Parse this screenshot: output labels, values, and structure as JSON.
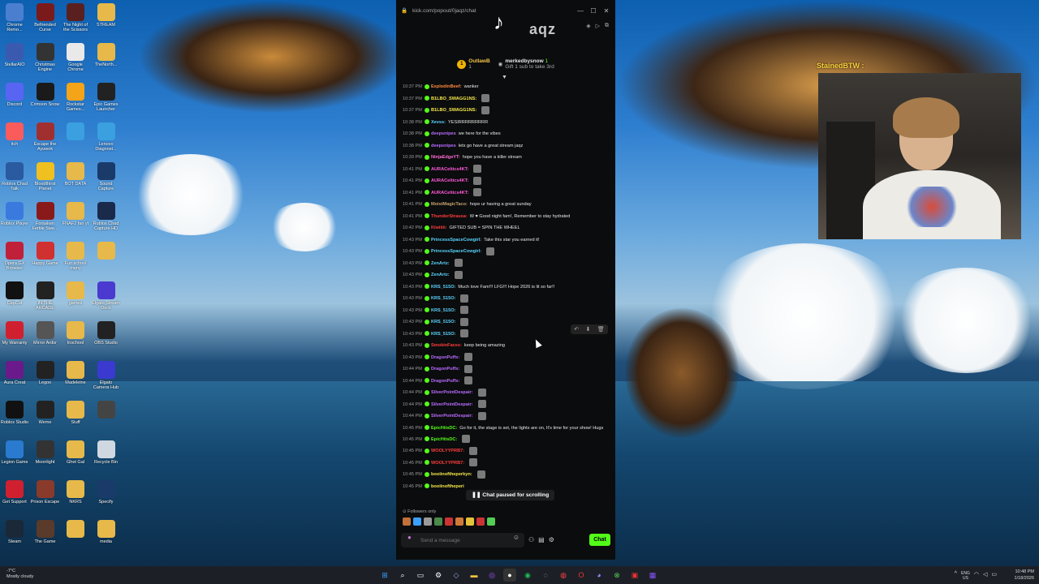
{
  "desktop": {
    "icons": [
      {
        "label": "Chrome Remo...",
        "color": "#4a7fd0"
      },
      {
        "label": "Befriended Curse",
        "color": "#7a1a1a"
      },
      {
        "label": "The Night of the Scissors",
        "color": "#5a2020"
      },
      {
        "label": "STREAM",
        "color": "#e6b94a"
      },
      {
        "label": "StellarAIO",
        "color": "#3a5ab0"
      },
      {
        "label": "Christmas Engine",
        "color": "#333333"
      },
      {
        "label": "Google Chrome",
        "color": "#e9e9e9"
      },
      {
        "label": "TheNorth...",
        "color": "#e6b94a"
      },
      {
        "label": "Discord",
        "color": "#5865f2"
      },
      {
        "label": "Crimson Snow",
        "color": "#1a1a1a"
      },
      {
        "label": "Rockstar Games...",
        "color": "#f4a418"
      },
      {
        "label": "Epic Games Launcher",
        "color": "#222222"
      },
      {
        "label": "itch",
        "color": "#fa5c5c"
      },
      {
        "label": "Escape the Ayuwok",
        "color": "#a03030"
      },
      {
        "label": "",
        "color": "#3aa0e0"
      },
      {
        "label": "Lenovo Diagnost...",
        "color": "#3aa0e0"
      },
      {
        "label": "Roblox Chad Talk",
        "color": "#2a5aa0"
      },
      {
        "label": "Bloodthirst Planet",
        "color": "#f0c020"
      },
      {
        "label": "BOT DATA",
        "color": "#e6b94a"
      },
      {
        "label": "Sound Capture",
        "color": "#1a3a6a"
      },
      {
        "label": "Roblox Player",
        "color": "#3a7adf"
      },
      {
        "label": "Forsaken Fertile Swe...",
        "color": "#8a1a1a"
      },
      {
        "label": "FNAF2 fan yt",
        "color": "#e6b94a"
      },
      {
        "label": "Roblox Chad Capture HD",
        "color": "#1a2a4a"
      },
      {
        "label": "Opera GX Browser",
        "color": "#c0203a"
      },
      {
        "label": "Happy Game",
        "color": "#d03030"
      },
      {
        "label": "Fun school meny",
        "color": "#e6b94a"
      },
      {
        "label": "",
        "color": "#e6b94a"
      },
      {
        "label": "CapCut",
        "color": "#111111"
      },
      {
        "label": "IN THE ARCADE",
        "color": "#222222"
      },
      {
        "label": "games",
        "color": "#e6b94a"
      },
      {
        "label": "Elgato Stream Deck",
        "color": "#4a3ad0"
      },
      {
        "label": "My Warranty",
        "color": "#d02030"
      },
      {
        "label": "Mirror Ardor",
        "color": "#555555"
      },
      {
        "label": "Inschool",
        "color": "#e6b94a"
      },
      {
        "label": "OBS Studio",
        "color": "#222222"
      },
      {
        "label": "Aura Creat",
        "color": "#6a1a8a"
      },
      {
        "label": "Legoo",
        "color": "#222222"
      },
      {
        "label": "Madeleine",
        "color": "#e6b94a"
      },
      {
        "label": "Elgato Camera Hub",
        "color": "#3a3ad0"
      },
      {
        "label": "Roblox Studio",
        "color": "#111111"
      },
      {
        "label": "Weme",
        "color": "#222222"
      },
      {
        "label": "Stuff",
        "color": "#e6b94a"
      },
      {
        "label": "",
        "color": "#444444"
      },
      {
        "label": "Legion Game",
        "color": "#2a7ad0"
      },
      {
        "label": "Moonlight",
        "color": "#333333"
      },
      {
        "label": "Ghet Gal",
        "color": "#e6b94a"
      },
      {
        "label": "Recycle Bin",
        "color": "#cfd8e0"
      },
      {
        "label": "Get Support",
        "color": "#d02030"
      },
      {
        "label": "Prison Escape",
        "color": "#8a3a2a"
      },
      {
        "label": "NKRS",
        "color": "#e6b94a"
      },
      {
        "label": "Specify",
        "color": "#1a3a6a"
      },
      {
        "label": "Steam",
        "color": "#1b2838"
      },
      {
        "label": "The Game",
        "color": "#5a3a2a"
      },
      {
        "label": "",
        "color": "#e6b94a"
      },
      {
        "label": "media",
        "color": "#e6b94a"
      }
    ]
  },
  "chat_window": {
    "url": "kick.com/popout/0jaqz/chat",
    "logo_glyph": "♪",
    "channel_name": "aqz",
    "pinned": {
      "user1": "OutlawB",
      "user1_count": "1",
      "user2": "merkedbysnow",
      "user2_note": "Gift 1 sub to take 3rd",
      "user2_count": "1"
    },
    "messages": [
      {
        "time": "10:37 PM",
        "user": "ExplodinBeef:",
        "text": "wanker",
        "color": "#ff8a3d",
        "emote": false
      },
      {
        "time": "10:37 PM",
        "user": "B1LBO_SWAGG1NS:",
        "text": "",
        "color": "#f7e94a",
        "emote": true
      },
      {
        "time": "10:37 PM",
        "user": "B1LBO_SWAGG1NS:",
        "text": "",
        "color": "#f7e94a",
        "emote": true
      },
      {
        "time": "10:38 PM",
        "user": "Xevss:",
        "text": "YESIRRRRRRRRR",
        "color": "#5ad5ff",
        "emote": false
      },
      {
        "time": "10:38 PM",
        "user": "deepsnipes",
        "text": "we here for the vibes",
        "color": "#b86bff",
        "emote": false
      },
      {
        "time": "10:38 PM",
        "user": "deepsnipes",
        "text": "lets go have a great stream jaqz",
        "color": "#b86bff",
        "emote": false
      },
      {
        "time": "10:39 PM",
        "user": "NinjaEdgeYT:",
        "text": "hope you have a killer stream",
        "color": "#ff6bd5",
        "emote": false
      },
      {
        "time": "10:41 PM",
        "user": "AURACeltics4KT:",
        "text": "",
        "color": "#ff5ad9",
        "emote": true
      },
      {
        "time": "10:41 PM",
        "user": "AURACeltics4KT:",
        "text": "",
        "color": "#ff5ad9",
        "emote": true
      },
      {
        "time": "10:41 PM",
        "user": "AURACeltics4KT:",
        "text": "",
        "color": "#ff5ad9",
        "emote": true
      },
      {
        "time": "10:41 PM",
        "user": "MoistMagicTaco:",
        "text": "hope ur having a great sunday",
        "color": "#c7a36b",
        "emote": false
      },
      {
        "time": "10:41 PM",
        "user": "ThunderStrausa:",
        "text": "W ♥ Good night fam!, Remember to stay hydrated",
        "color": "#ff3d3d",
        "emote": false
      },
      {
        "time": "10:42 PM",
        "user": "Kiwiiiii:",
        "text": "GIFTED SUB = SPIN THE WHEEL",
        "color": "#ff3d3d",
        "emote": false
      },
      {
        "time": "10:43 PM",
        "user": "PrincessSpaceCowgirl:",
        "text": "Take this star  you earned it!",
        "color": "#5ad5ff",
        "emote": false
      },
      {
        "time": "10:43 PM",
        "user": "PrincessSpaceCowgirl:",
        "text": "",
        "color": "#5ad5ff",
        "emote": true
      },
      {
        "time": "10:43 PM",
        "user": "ZenArtz:",
        "text": "",
        "color": "#5ad5ff",
        "emote": true
      },
      {
        "time": "10:43 PM",
        "user": "ZenArtz:",
        "text": "",
        "color": "#5ad5ff",
        "emote": true
      },
      {
        "time": "10:43 PM",
        "user": "KRS_515O:",
        "text": "Much love Fam!!! LFG!!! Hope 2026 is lit so far!!",
        "color": "#5ad5ff",
        "emote": false
      },
      {
        "time": "10:43 PM",
        "user": "KRS_515O:",
        "text": "",
        "color": "#5ad5ff",
        "emote": true
      },
      {
        "time": "10:43 PM",
        "user": "KRS_515O:",
        "text": "",
        "color": "#5ad5ff",
        "emote": true
      },
      {
        "time": "10:43 PM",
        "user": "KRS_515O:",
        "text": "",
        "color": "#5ad5ff",
        "emote": true
      },
      {
        "time": "10:43 PM",
        "user": "KRS_515O:",
        "text": "",
        "color": "#5ad5ff",
        "emote": true
      },
      {
        "time": "10:43 PM",
        "user": "SmokinFaces:",
        "text": "keep being amazing",
        "color": "#ff3d3d",
        "emote": false
      },
      {
        "time": "10:43 PM",
        "user": "DragonPuffs:",
        "text": "",
        "color": "#b86bff",
        "emote": true
      },
      {
        "time": "10:44 PM",
        "user": "DragonPuffs:",
        "text": "",
        "color": "#b86bff",
        "emote": true
      },
      {
        "time": "10:44 PM",
        "user": "DragonPuffs:",
        "text": "",
        "color": "#b86bff",
        "emote": true
      },
      {
        "time": "10:44 PM",
        "user": "SilverPointDespair:",
        "text": "",
        "color": "#b86bff",
        "emote": true
      },
      {
        "time": "10:44 PM",
        "user": "SilverPointDespair:",
        "text": "",
        "color": "#b86bff",
        "emote": true
      },
      {
        "time": "10:44 PM",
        "user": "SilverPointDespair:",
        "text": "",
        "color": "#b86bff",
        "emote": true
      }
    ],
    "wrap_message": {
      "time": "10:45 PM",
      "user": "EpicHitsDC:",
      "text": "Go for it, the stage is set, the lights are on, It's time for your show! Hugs",
      "color": "#53fc18"
    },
    "after_messages": [
      {
        "time": "10:45 PM",
        "user": "EpicHitsDC:",
        "text": "",
        "color": "#53fc18",
        "emote": true
      },
      {
        "time": "10:45 PM",
        "user": "WOOLYYPRB7:",
        "text": "",
        "color": "#ff3d3d",
        "emote": true
      },
      {
        "time": "10:45 PM",
        "user": "WOOLYYPRB7:",
        "text": "",
        "color": "#ff3d3d",
        "emote": true
      },
      {
        "time": "10:45 PM",
        "user": "booiinoftheperkyn:",
        "text": "",
        "color": "#f7e94a",
        "emote": true
      },
      {
        "time": "10:45 PM",
        "user": "booiinoftheperi",
        "text": "",
        "color": "#f7e94a",
        "emote": false
      }
    ],
    "paused_label": "Chat paused for scrolling",
    "followers_only": "Followers only",
    "input_placeholder": "Send a message",
    "chat_button": "Chat"
  },
  "webcam": {
    "streamer_name": "StainedBTW :"
  },
  "taskbar": {
    "weather_temp": "-7°C",
    "weather_desc": "Mostly cloudy",
    "lang": "ENG",
    "region": "US",
    "time": "10:48 PM",
    "date": "1/18/2026"
  }
}
